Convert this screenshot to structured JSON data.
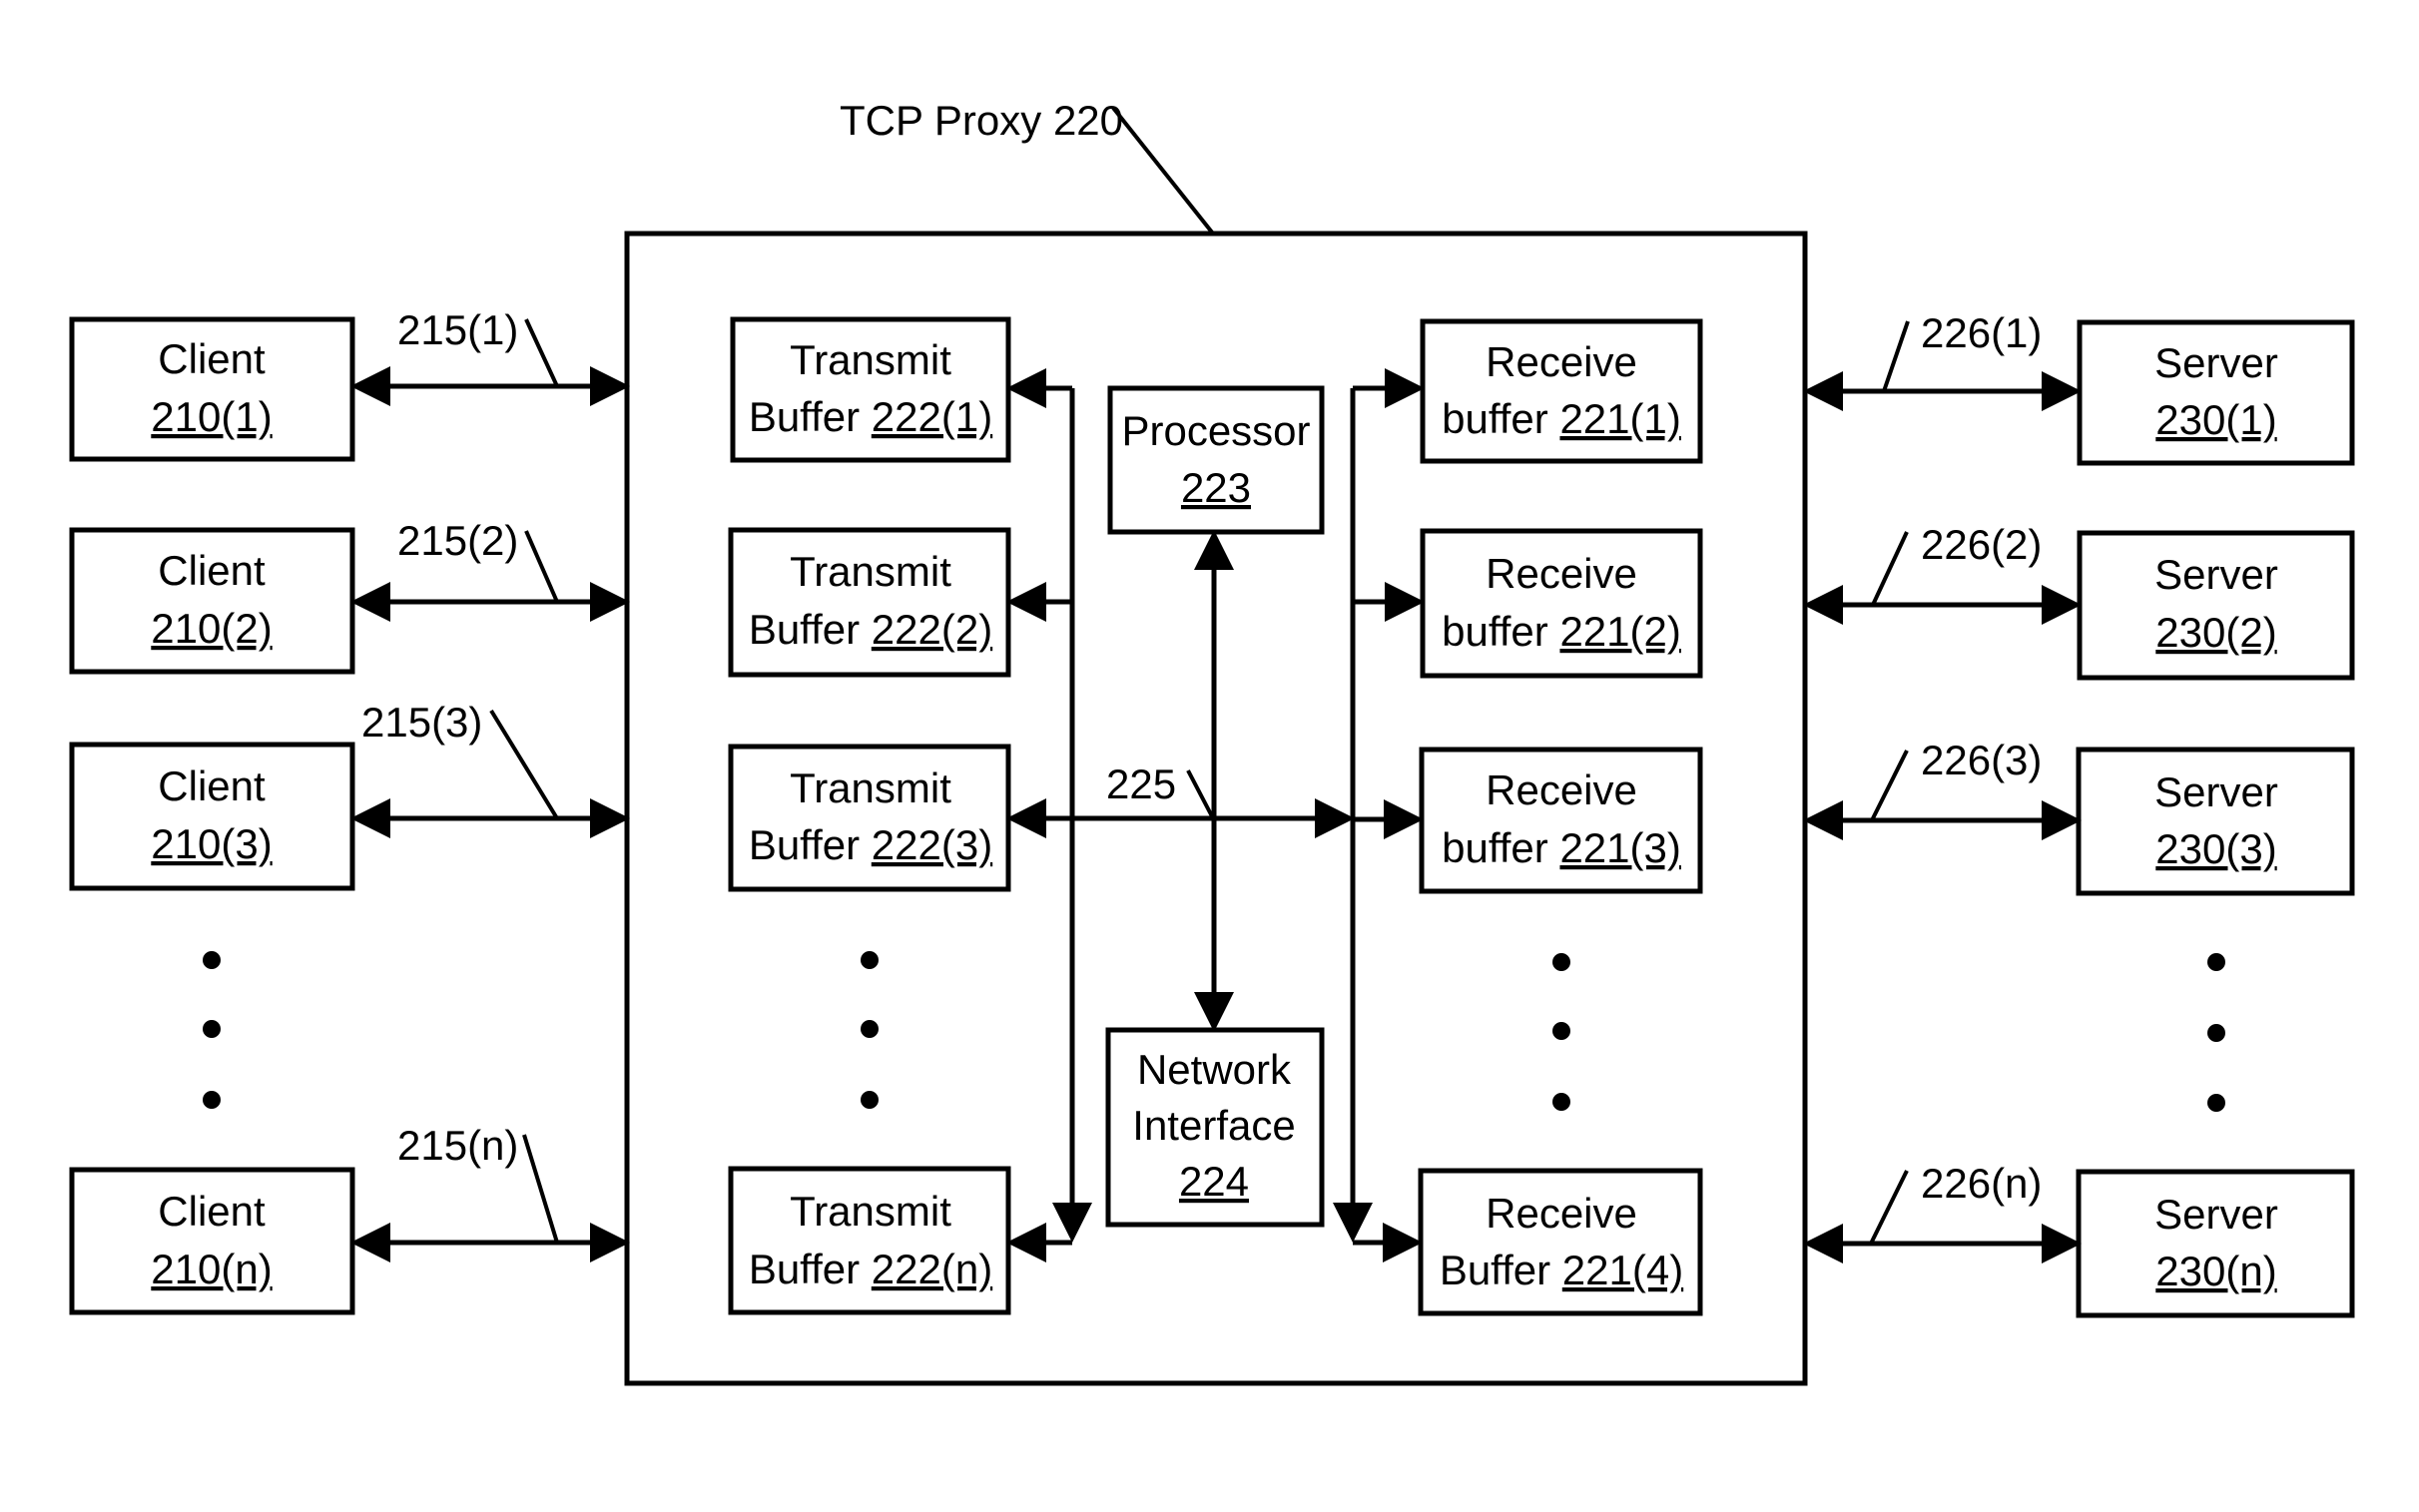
{
  "proxy": {
    "label": "TCP Proxy 220"
  },
  "clients": [
    {
      "title": "Client",
      "id": "210(1)",
      "link": "215(1)"
    },
    {
      "title": "Client",
      "id": "210(2)",
      "link": "215(2)"
    },
    {
      "title": "Client",
      "id": "210(3)",
      "link": "215(3)"
    },
    {
      "title": "Client",
      "id": "210(n)",
      "link": "215(n)"
    }
  ],
  "transmit_buffers": [
    {
      "title": "Transmit",
      "prefix": "Buffer",
      "id": "222(1)"
    },
    {
      "title": "Transmit",
      "prefix": "Buffer",
      "id": "222(2)"
    },
    {
      "title": "Transmit",
      "prefix": "Buffer",
      "id": "222(3)"
    },
    {
      "title": "Transmit",
      "prefix": "Buffer",
      "id": "222(n)"
    }
  ],
  "receive_buffers": [
    {
      "title": "Receive",
      "prefix": "buffer",
      "id": "221(1)"
    },
    {
      "title": "Receive",
      "prefix": "buffer",
      "id": "221(2)"
    },
    {
      "title": "Receive",
      "prefix": "buffer",
      "id": "221(3)"
    },
    {
      "title": "Receive",
      "prefix": "Buffer",
      "id": "221(4)"
    }
  ],
  "servers": [
    {
      "title": "Server",
      "id": "230(1)",
      "link": "226(1)"
    },
    {
      "title": "Server",
      "id": "230(2)",
      "link": "226(2)"
    },
    {
      "title": "Server",
      "id": "230(3)",
      "link": "226(3)"
    },
    {
      "title": "Server",
      "id": "230(n)",
      "link": "226(n)"
    }
  ],
  "processor": {
    "title": "Processor",
    "id": "223"
  },
  "network_interface": {
    "line1": "Network",
    "line2": "Interface",
    "id": "224"
  },
  "bus": {
    "label": "225"
  }
}
